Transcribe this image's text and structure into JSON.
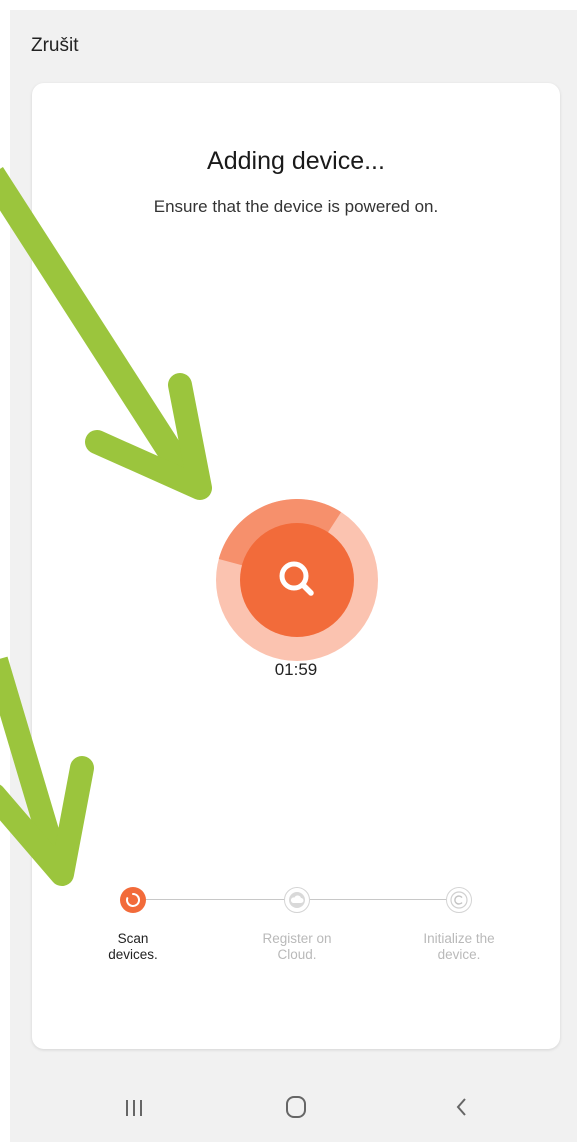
{
  "header": {
    "cancel_label": "Zrušit"
  },
  "main": {
    "title": "Adding device...",
    "subtitle": "Ensure that the device is powered on.",
    "timer": "01:59",
    "progress_fraction": 0.3
  },
  "steps": [
    {
      "label_line1": "Scan",
      "label_line2": "devices.",
      "status": "active"
    },
    {
      "label_line1": "Register on",
      "label_line2": "Cloud.",
      "status": "pending"
    },
    {
      "label_line1": "Initialize the",
      "label_line2": "device.",
      "status": "pending"
    }
  ],
  "colors": {
    "accent": "#f26b3a",
    "accent_light": "#fbc3b0",
    "pending": "#c8c8c8",
    "annotation_arrow": "#9bc53d"
  },
  "navbar": {
    "icons": [
      "recent-apps-icon",
      "home-icon",
      "back-icon"
    ]
  }
}
